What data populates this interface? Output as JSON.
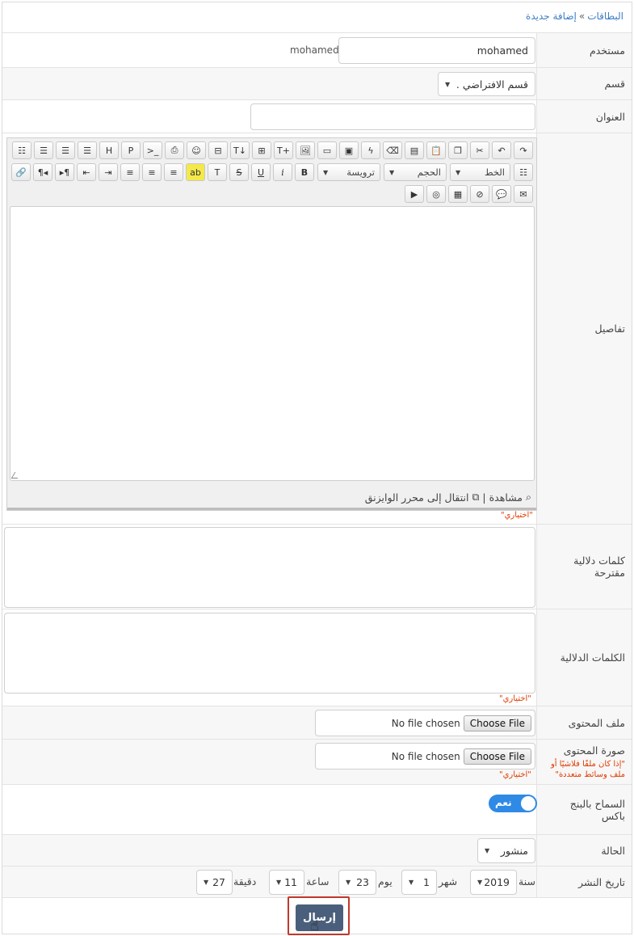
{
  "breadcrumb": {
    "root": "البطاقات",
    "separator": "»",
    "current": "إضافة جديدة"
  },
  "user": {
    "label": "مستخدم",
    "value": "mohamed",
    "display": "mohamed"
  },
  "category": {
    "label": "قسم",
    "selected": "قسم الافتراضي ."
  },
  "title_field": {
    "label": "العنوان",
    "value": ""
  },
  "details": {
    "label": "تفاصيل",
    "toolbar": {
      "font_label": "الخط",
      "size_label": "الحجم",
      "heading_label": "ترويسة"
    },
    "footer_preview": "مشاهدة",
    "footer_sep": "|",
    "footer_switch": "انتقال إلى محرر الوايزنق",
    "optional": "\"اختياري\""
  },
  "suggested_tags": {
    "label": "كلمات دلالية مقترحة"
  },
  "tags": {
    "label": "الكلمات الدلالية",
    "optional": "\"اختياري\""
  },
  "content_file": {
    "label": "ملف المحتوى",
    "button": "Choose File",
    "status": "No file chosen"
  },
  "content_image": {
    "label": "صورة المحتوى",
    "note": "\"إذا كان ملفًا فلاشيًا أو ملف وسائط متعددة\"",
    "button": "Choose File",
    "status": "No file chosen",
    "optional": "\"اختياري\""
  },
  "allow_ping": {
    "label": "السماح بالبنج باكس",
    "toggle_text": "نعم",
    "accent": "#2f8ae6"
  },
  "status": {
    "label": "الحالة",
    "selected": "منشور"
  },
  "publish_date": {
    "label": "تاريخ النشر",
    "year_label": "سنة",
    "year": "2019",
    "month_label": "شهر",
    "month": "1",
    "day_label": "يوم",
    "day": "23",
    "hour_label": "ساعة",
    "hour": "11",
    "minute_label": "دقيقة",
    "minute": "27"
  },
  "submit": {
    "label": "إرسال",
    "color": "#4a5f7c"
  },
  "icons": [
    "undo-icon",
    "redo-icon",
    "cut-icon",
    "copy-icon",
    "paste-icon",
    "paste-text-icon",
    "remove-format-icon",
    "image-icon",
    "flash-icon",
    "media-icon",
    "link-icon",
    "emoji-icon",
    "bold-icon",
    "italic-icon",
    "underline-icon",
    "strike-icon",
    "text-color-icon",
    "highlight-icon",
    "align-icon",
    "indent-icon",
    "list-icon",
    "email-icon",
    "comment-icon",
    "video-icon"
  ]
}
